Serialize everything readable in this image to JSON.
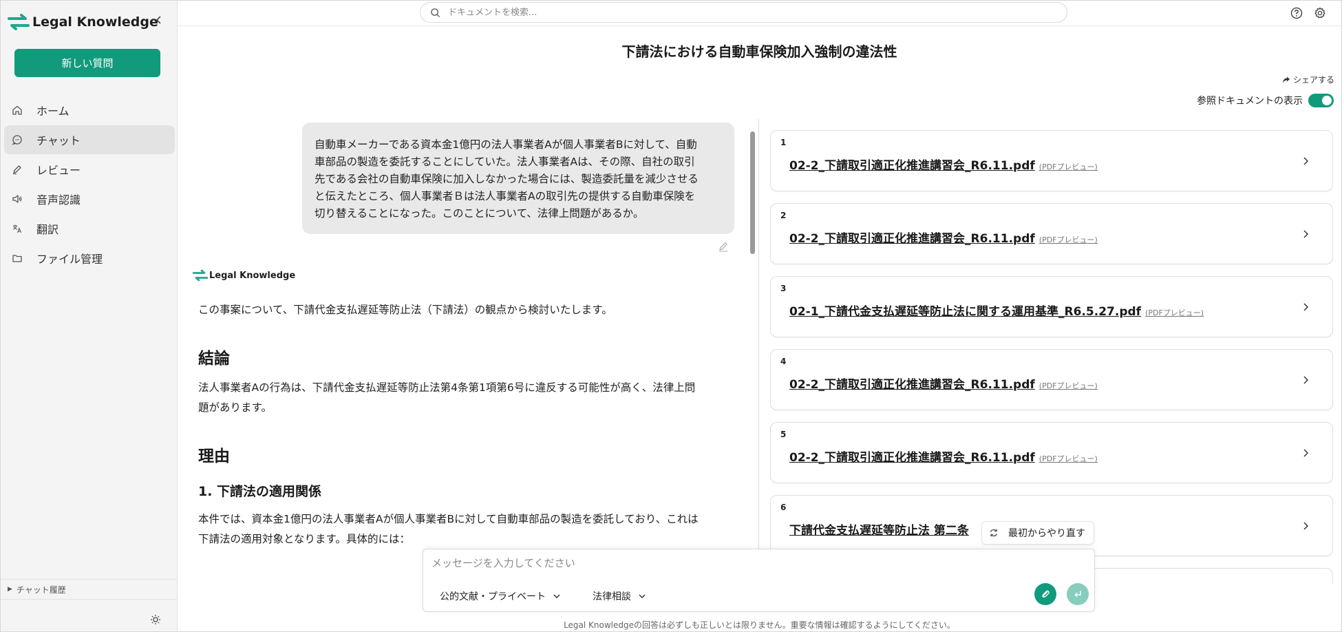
{
  "app": {
    "brand": "Legal Knowledge",
    "new_question_label": "新しい質問",
    "chat_history_label": "チャット履歴"
  },
  "sidebar": {
    "items": [
      {
        "label": "ホーム",
        "icon": "home-icon"
      },
      {
        "label": "チャット",
        "icon": "chat-icon",
        "active": true
      },
      {
        "label": "レビュー",
        "icon": "pen-icon"
      },
      {
        "label": "音声認識",
        "icon": "speaker-icon"
      },
      {
        "label": "翻訳",
        "icon": "translate-icon"
      },
      {
        "label": "ファイル管理",
        "icon": "folder-icon"
      }
    ]
  },
  "header": {
    "search_placeholder": "ドキュメントを検索...",
    "title": "下請法における自動車保険加入強制の違法性",
    "share_label": "シェアする",
    "toggle_label": "参照ドキュメントの表示",
    "toggle_on": true
  },
  "chat": {
    "user_message_lines": [
      "自動車メーカーである資本金1億円の法人事業者Aが個人事業者Bに対して、自動",
      "車部品の製造を委託することにしていた。法人事業者Aは、その際、自社の取引",
      "先である会社の自動車保険に加入しなかった場合には、製造委託量を減少させる",
      "と伝えたところ、個人事業者Ｂは法人事業者Aの取引先の提供する自動車保険を",
      "切り替えることになった。このことについて、法律上問題があるか。"
    ],
    "answer_brand": "Legal Knowledge",
    "answer": {
      "intro": "この事案について、下請代金支払遅延等防止法（下請法）の観点から検討いたします。",
      "conclusion_heading": "結論",
      "conclusion_line1": "法人事業者Aの行為は、下請代金支払遅延等防止法第4条第1項第6号に違反する可能性が高く、法律上問",
      "conclusion_line2": "題があります。",
      "reason_heading": "理由",
      "section1_heading": "1. 下請法の適用関係",
      "section1_line1": "本件では、資本金1億円の法人事業者Aが個人事業者Bに対して自動車部品の製造を委託しており、これは",
      "section1_line2": "下請法の適用対象となります。具体的には："
    }
  },
  "references": [
    {
      "num": "1",
      "title": "02-2_下請取引適正化推進講習会_R6.11.pdf",
      "tag": "(PDFプレビュー)"
    },
    {
      "num": "2",
      "title": "02-2_下請取引適正化推進講習会_R6.11.pdf",
      "tag": "(PDFプレビュー)"
    },
    {
      "num": "3",
      "title": "02-1_下請代金支払遅延等防止法に関する運用基準_R6.5.27.pdf",
      "tag": "(PDFプレビュー)"
    },
    {
      "num": "4",
      "title": "02-2_下請取引適正化推進講習会_R6.11.pdf",
      "tag": "(PDFプレビュー)"
    },
    {
      "num": "5",
      "title": "02-2_下請取引適正化推進講習会_R6.11.pdf",
      "tag": "(PDFプレビュー)"
    },
    {
      "num": "6",
      "title": "下請代金支払遅延等防止法 第二条",
      "tag": ""
    }
  ],
  "restart_label": "最初からやり直す",
  "composer": {
    "placeholder": "メッセージを入力してください",
    "source_select": "公的文献・プライベート",
    "mode_select": "法律相談"
  },
  "footer": {
    "disclaimer": "Legal Knowledgeの回答は必ずしも正しいとは限りません。重要な情報は確認するようにしてください。"
  },
  "colors": {
    "accent": "#119a7c",
    "accent_light": "#86cdbd",
    "sidebar_bg": "#f4f4f4",
    "bubble_bg": "#e9e9e9"
  }
}
